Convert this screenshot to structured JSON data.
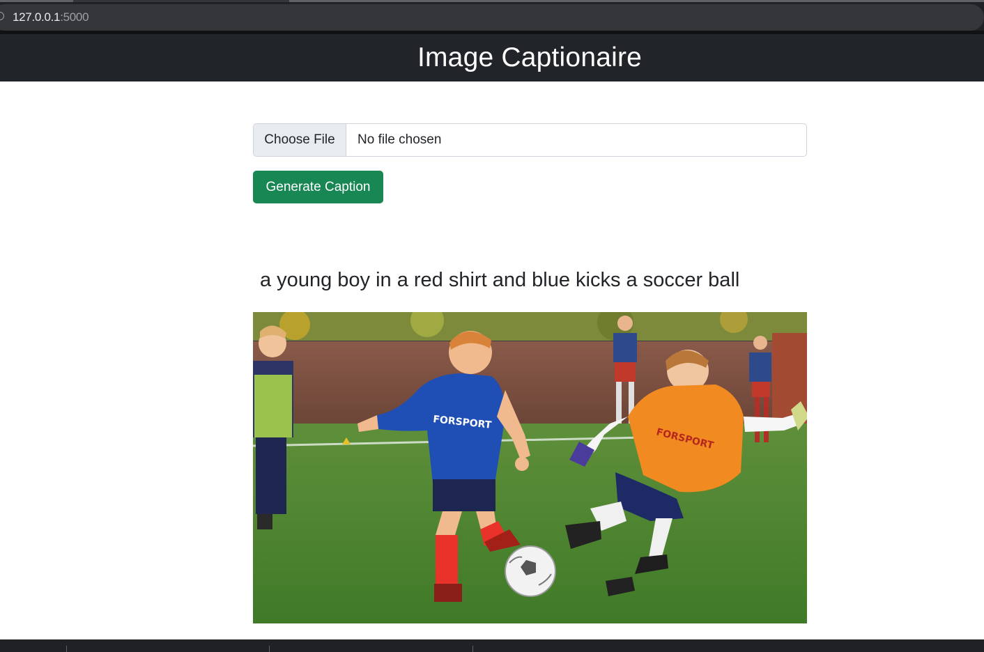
{
  "browser": {
    "url_host": "127.0.0.1",
    "url_port": ":5000"
  },
  "navbar": {
    "title": "Image Captionaire"
  },
  "form": {
    "choose_file_label": "Choose File",
    "file_status": "No file chosen",
    "submit_label": "Generate Caption"
  },
  "result": {
    "caption": "a young boy in a red shirt and blue kicks a soccer ball",
    "image_shirt_text_1": "FORSPORT",
    "image_shirt_text_2": "FORSPORT"
  },
  "colors": {
    "navbar_bg": "#212529",
    "button_green": "#198754",
    "file_button_bg": "#e9ecef"
  }
}
